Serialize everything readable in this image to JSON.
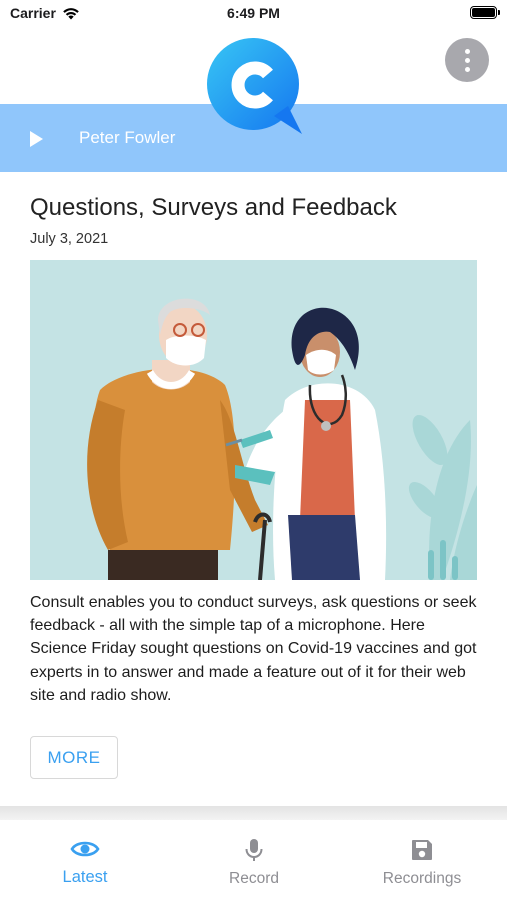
{
  "status_bar": {
    "carrier": "Carrier",
    "time": "6:49 PM",
    "battery_level": 1.0,
    "icons": [
      "wifi-icon",
      "battery-icon"
    ]
  },
  "header": {
    "logo_icon": "consult-logo",
    "menu_icon": "more-vertical-icon"
  },
  "player": {
    "play_icon": "play-icon",
    "name": "Peter Fowler",
    "background_color": "#90c6fb"
  },
  "article": {
    "title": "Questions, Surveys and Feedback",
    "date": "July 3, 2021",
    "body": "Consult enables you to conduct surveys, ask questions or seek feedback - all with the simple tap of a microphone.  Here Science Friday sought questions on Covid-19 vaccines and got experts in to answer and made a feature out of it for their web site and radio show.",
    "more_label": "MORE"
  },
  "tabs": [
    {
      "label": "Latest",
      "icon": "eye-icon",
      "active": true
    },
    {
      "label": "Record",
      "icon": "microphone-icon",
      "active": false
    },
    {
      "label": "Recordings",
      "icon": "save-icon",
      "active": false
    }
  ],
  "colors": {
    "accent": "#3aa0f0",
    "inactive": "#8e8e93",
    "illustration_bg": "#c4e3e4"
  }
}
